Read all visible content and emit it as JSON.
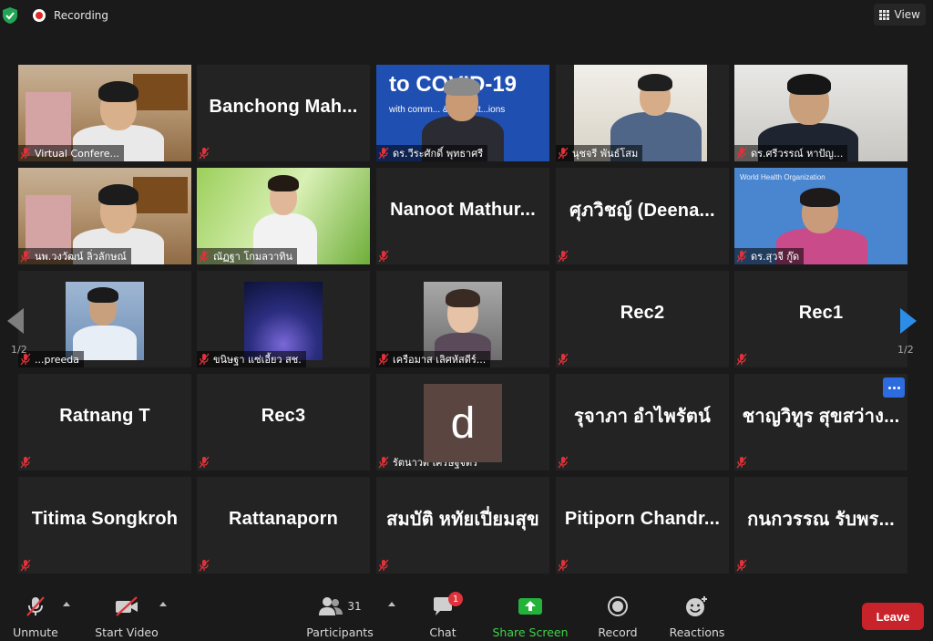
{
  "topbar": {
    "recording_label": "Recording",
    "view_label": "View"
  },
  "tiles": [
    {
      "name": "Virtual Confere...",
      "video": "room-man"
    },
    {
      "name": "Banchong  Mah...",
      "video": "none"
    },
    {
      "name": "ดร.วีระศักดิ์ พุทธาศรี",
      "video": "covid",
      "banner": "to COVID-19",
      "sub": "with comm... & innovat...ions"
    },
    {
      "name": "นุชจรี พันธ์โสม",
      "video": "bright-woman"
    },
    {
      "name": "ดร.ศรีวรรณ์ หาปัญ...",
      "video": "white-man"
    },
    {
      "name": "นพ.วงวัฒน์ ลิ่วลักษณ์",
      "video": "room-man"
    },
    {
      "name": "ณัฏฐา โกมลวาทิน",
      "video": "green-woman"
    },
    {
      "name": "Nanoot  Mathur...",
      "video": "none"
    },
    {
      "name": "ศุภวิชญ์ (Deena...",
      "video": "none"
    },
    {
      "name": "ดร.สุวจี กู๊ด",
      "video": "who-woman",
      "logo": "World Health Organization"
    },
    {
      "name": "...preeda",
      "video": "portrait-man"
    },
    {
      "name": "ขนิษฐา แซ่เอี้ยว สช.",
      "video": "space"
    },
    {
      "name": "เครือมาส เลิศหัสดีร์...",
      "video": "avatar"
    },
    {
      "name": "Rec2",
      "video": "none"
    },
    {
      "name": "Rec1",
      "video": "none"
    },
    {
      "name": "Ratnang T",
      "video": "none"
    },
    {
      "name": "Rec3",
      "video": "none"
    },
    {
      "name": "รัตนาวดี เศรษฐจิตร",
      "video": "letter",
      "letter": "d"
    },
    {
      "name": "รุจาภา อำไพรัตน์",
      "video": "none"
    },
    {
      "name": "ชาญวิทูร สุขสว่าง...",
      "video": "none"
    },
    {
      "name": "Titima Songkroh",
      "video": "none"
    },
    {
      "name": "Rattanaporn",
      "video": "none"
    },
    {
      "name": "สมบัติ หทัยเปี่ยมสุข",
      "video": "none"
    },
    {
      "name": "Pitiporn  Chandr...",
      "video": "none"
    },
    {
      "name": "กนกวรรณ รับพร...",
      "video": "none"
    }
  ],
  "pagination": {
    "left": "1/2",
    "right": "1/2"
  },
  "toolbar": {
    "unmute_label": "Unmute",
    "start_video_label": "Start Video",
    "participants_label": "Participants",
    "participants_count": "31",
    "chat_label": "Chat",
    "chat_badge": "1",
    "share_label": "Share Screen",
    "record_label": "Record",
    "reactions_label": "Reactions",
    "leave_label": "Leave"
  },
  "colors": {
    "accent_green": "#3fd24a",
    "leave_red": "#c8232b",
    "highlight": "#e0d44a",
    "active_blue": "#2c8ce8"
  }
}
